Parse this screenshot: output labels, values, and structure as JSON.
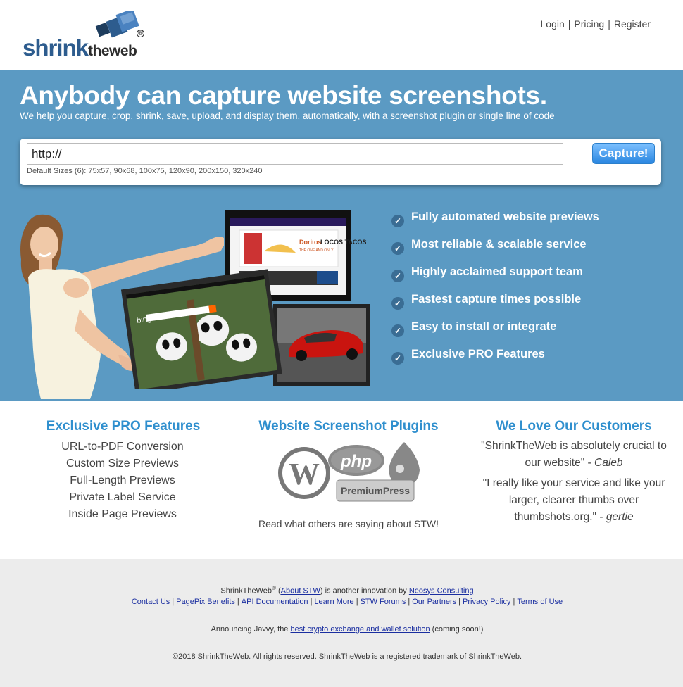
{
  "header": {
    "logo": {
      "word_shrink": "shrink",
      "word_the": "the",
      "word_web": "web",
      "registered": "®"
    },
    "nav": [
      {
        "label": "Login"
      },
      {
        "label": "Pricing"
      },
      {
        "label": "Register"
      }
    ]
  },
  "hero": {
    "title": "Anybody can capture website screenshots.",
    "subtitle": "We help you capture, crop, shrink, save, upload, and display them, automatically, with a screenshot plugin or single line of code",
    "url_value": "http://",
    "capture_label": "Capture!",
    "default_sizes": "Default Sizes (6): 75x57, 90x68, 100x75, 120x90, 200x150, 320x240",
    "features": [
      "Fully automated website previews",
      "Most reliable & scalable service",
      "Highly acclaimed support team",
      "Fastest capture times possible",
      "Easy to install or integrate",
      "Exclusive PRO Features"
    ],
    "screens": {
      "bing_label": "bing",
      "doritos_brand": "Doritos",
      "doritos_tacos": "LOCOS TACOS",
      "doritos_tagline": "THE ONE AND ONLY."
    }
  },
  "middle": {
    "pro": {
      "title": "Exclusive PRO Features",
      "items": [
        "URL-to-PDF Conversion",
        "Custom Size Previews",
        "Full-Length Previews",
        "Private Label Service",
        "Inside Page Previews"
      ]
    },
    "plugins": {
      "title": "Website Screenshot Plugins",
      "php_label": "php",
      "premium_label": "PremiumPress",
      "read_link": "Read what others are saying about STW!"
    },
    "customers": {
      "title": "We Love Our Customers",
      "quotes": [
        {
          "text": "\"ShrinkTheWeb is absolutely crucial to our website\" - ",
          "author": "Caleb"
        },
        {
          "text": "\"I really like your service and like your larger, clearer thumbs over thumbshots.org.\" - ",
          "author": "gertie"
        }
      ]
    }
  },
  "footer": {
    "line1_prefix": "ShrinkTheWeb",
    "line1_sup": "®",
    "line1_open": " (",
    "line1_about": "About STW",
    "line1_mid": ") is another innovation by ",
    "line1_company": "Neosys Consulting",
    "links": [
      "Contact Us",
      "PagePix Benefits",
      "API Documentation",
      "Learn More",
      "STW Forums",
      "Our Partners",
      "Privacy Policy",
      "Terms of Use"
    ],
    "announce_prefix": "Announcing Javvy, the ",
    "announce_link": "best crypto exchange and wallet solution",
    "announce_suffix": " (coming soon!)",
    "copyright": "©2018 ShrinkTheWeb. All rights reserved. ShrinkTheWeb is a registered trademark of ShrinkTheWeb."
  },
  "colors": {
    "hero_bg": "#5b9ac3",
    "accent_blue": "#2f8fce",
    "logo_blue": "#2d5c8e",
    "footer_bg": "#ececec",
    "link_blue": "#1a2ea0"
  }
}
